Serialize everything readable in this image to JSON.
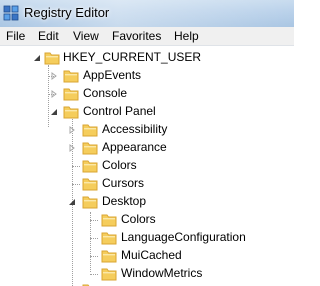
{
  "window": {
    "title": "Registry Editor",
    "icon": "registry-editor-icon"
  },
  "menubar": {
    "items": [
      {
        "label": "File"
      },
      {
        "label": "Edit"
      },
      {
        "label": "View"
      },
      {
        "label": "Favorites"
      },
      {
        "label": "Help"
      }
    ]
  },
  "tree": {
    "root": {
      "label": "HKEY_CURRENT_USER",
      "expanded": true
    },
    "nodes": [
      {
        "label": "AppEvents",
        "state": "collapsed"
      },
      {
        "label": "Console",
        "state": "collapsed"
      },
      {
        "label": "Control Panel",
        "state": "expanded"
      },
      {
        "label": "Accessibility",
        "state": "collapsed"
      },
      {
        "label": "Appearance",
        "state": "collapsed"
      },
      {
        "label": "Colors",
        "state": "leaf"
      },
      {
        "label": "Cursors",
        "state": "leaf"
      },
      {
        "label": "Desktop",
        "state": "expanded"
      },
      {
        "label": "Colors",
        "state": "leaf"
      },
      {
        "label": "LanguageConfiguration",
        "state": "leaf"
      },
      {
        "label": "MuiCached",
        "state": "leaf"
      },
      {
        "label": "WindowMetrics",
        "state": "leaf"
      }
    ]
  },
  "colors": {
    "folder": "#f5cd5c",
    "folder_dark": "#d9a532",
    "expander_open": "#404040",
    "expander_closed": "#a8a8a8"
  }
}
